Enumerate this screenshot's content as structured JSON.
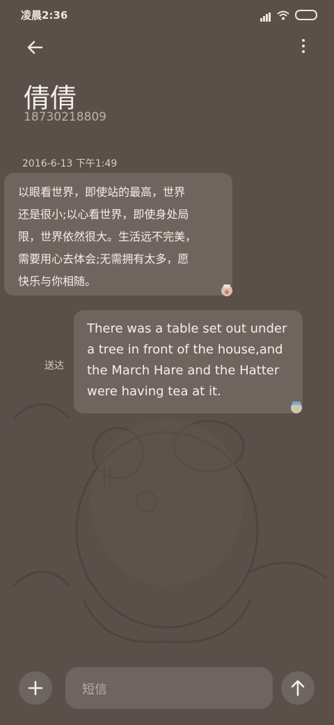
{
  "status_bar": {
    "time": "凌晨2:36"
  },
  "header": {
    "contact_name": "倩倩",
    "phone": "18730218809"
  },
  "conversation": {
    "timestamp": "2016-6-13 下午1:49",
    "messages": [
      {
        "direction": "incoming",
        "text": "以眼看世界，即使站的最高，世界\n还是很小;以心看世界，即使身处局\n限，世界依然很大。生活远不完美，\n需要用心去体会;无需拥有太多，愿\n快乐与你相随。"
      },
      {
        "direction": "outgoing",
        "status": "送达",
        "text": "There was a table set out under\na tree in front of the house,and\nthe March Hare and the Hatter\nwere having tea at it."
      }
    ]
  },
  "composer": {
    "placeholder": "短信"
  },
  "icons": {
    "back": "arrow-left-icon",
    "menu": "more-vertical-icon",
    "add": "plus-icon",
    "send": "arrow-up-icon"
  },
  "colors": {
    "background": "#5a5049",
    "bubble": "#786e66",
    "button": "#6e6560"
  }
}
